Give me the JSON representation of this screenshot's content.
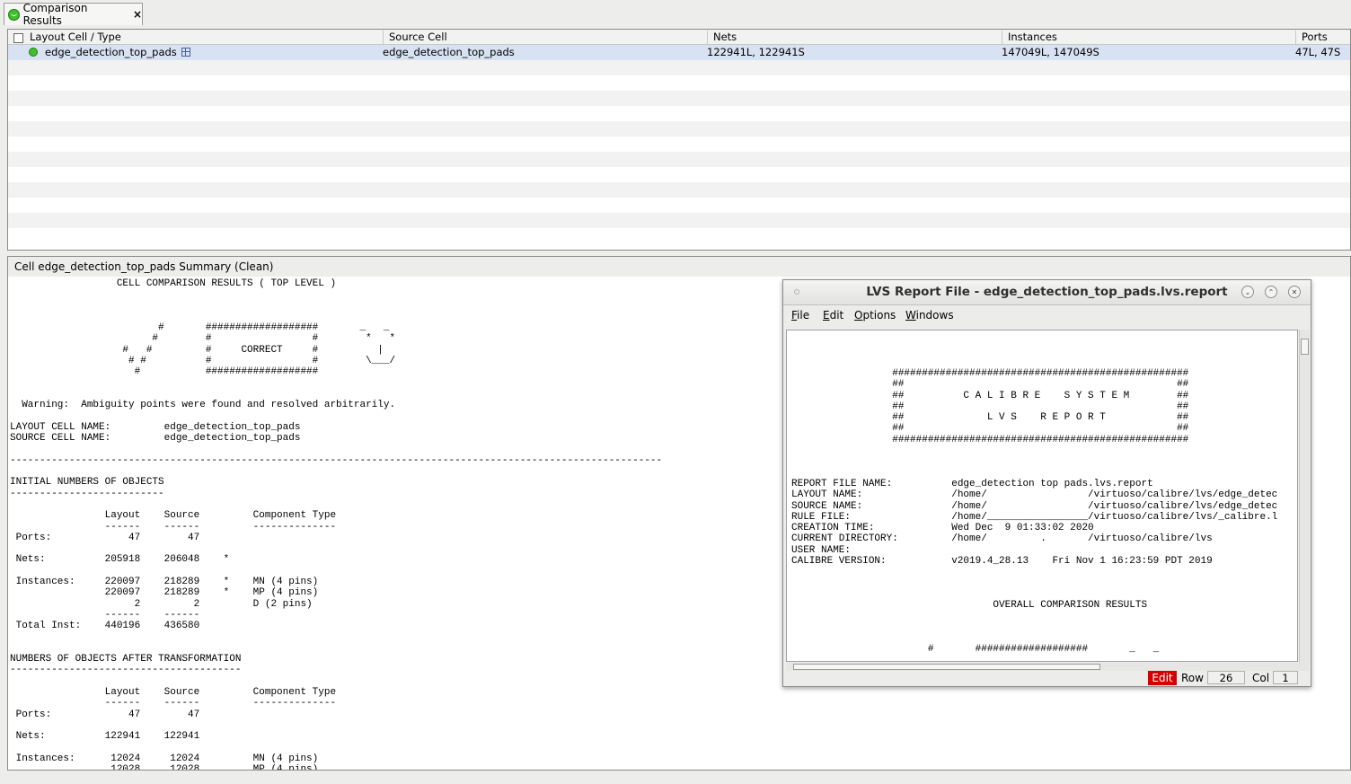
{
  "tab": {
    "label": "Comparison Results",
    "close": "×"
  },
  "table": {
    "headers": [
      "Layout Cell / Type",
      "Source Cell",
      "Nets",
      "Instances",
      "Ports"
    ],
    "row": {
      "layout_cell": "edge_detection_top_pads",
      "source_cell": "edge_detection_top_pads",
      "nets": "122941L, 122941S",
      "instances": "147049L, 147049S",
      "ports": "47L, 47S"
    }
  },
  "summary": {
    "title": "Cell edge_detection_top_pads Summary (Clean)",
    "report_text": "                  CELL COMPARISON RESULTS ( TOP LEVEL )\n\n\n\n                         #       ###################       _   _\n                        #        #                 #        *   *\n                   #   #         #     CORRECT     #          |\n                    # #          #                 #        \\___/\n                     #           ###################\n\n\n  Warning:  Ambiguity points were found and resolved arbitrarily.\n\nLAYOUT CELL NAME:         edge_detection_top_pads\nSOURCE CELL NAME:         edge_detection_top_pads\n\n--------------------------------------------------------------------------------------------------------------\n\nINITIAL NUMBERS OF OBJECTS\n--------------------------\n\n                Layout    Source         Component Type\n                ------    ------         --------------\n Ports:             47        47\n\n Nets:          205918    206048    *\n\n Instances:     220097    218289    *    MN (4 pins)\n                220097    218289    *    MP (4 pins)\n                     2         2         D (2 pins)\n                ------    ------\n Total Inst:    440196    436580\n\n\nNUMBERS OF OBJECTS AFTER TRANSFORMATION\n---------------------------------------\n\n                Layout    Source         Component Type\n                ------    ------         --------------\n Ports:             47        47\n\n Nets:          122941    122941\n\n Instances:      12024     12024         MN (4 pins)\n                 12028     12028         MP (4 pins)"
  },
  "report_window": {
    "title": "LVS Report File - edge_detection_top_pads.lvs.report",
    "menu": [
      "File",
      "Edit",
      "Options",
      "Windows"
    ],
    "text": "                 ##################################################\n                 ##                                              ##\n                 ##          C A L I B R E    S Y S T E M        ##\n                 ##                                              ##\n                 ##              L V S    R E P O R T            ##\n                 ##                                              ##\n                 ##################################################\n\n\n\nREPORT FILE NAME:          edge_detection top pads.lvs.report\nLAYOUT NAME:               /home/                 /virtuoso/calibre/lvs/edge_detec\nSOURCE NAME:               /home/                 /virtuoso/calibre/lvs/edge_detec\nRULE FILE:                 /home/_________________/virtuoso/calibre/lvs/_calibre.l\nCREATION TIME:             Wed Dec  9 01:33:02 2020\nCURRENT DIRECTORY:         /home/         .       /virtuoso/calibre/lvs\nUSER NAME:\nCALIBRE VERSION:           v2019.4_28.13    Fri Nov 1 16:23:59 PDT 2019\n\n\n\n                                  OVERALL COMPARISON RESULTS\n\n\n\n                       #       ###################       _   _",
    "status": {
      "mode": "Edit",
      "row_label": "Row",
      "row_value": "26",
      "col_label": "Col",
      "col_value": "1"
    }
  }
}
